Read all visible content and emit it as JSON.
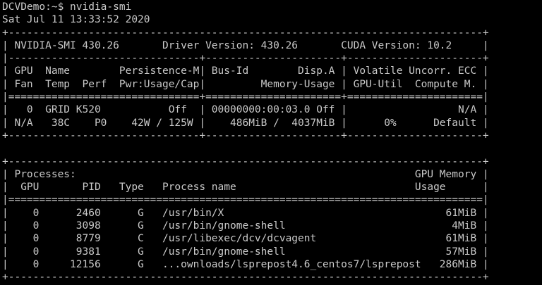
{
  "terminal": {
    "prompt_line": "DCVDemo:~$ nvidia-smi",
    "timestamp_line": "Sat Jul 11 13:33:52 2020",
    "gpu_table": [
      "+-----------------------------------------------------------------------------+",
      "| NVIDIA-SMI 430.26       Driver Version: 430.26       CUDA Version: 10.2     |",
      "|-------------------------------+----------------------+----------------------+",
      "| GPU  Name        Persistence-M| Bus-Id        Disp.A | Volatile Uncorr. ECC |",
      "| Fan  Temp  Perf  Pwr:Usage/Cap|         Memory-Usage | GPU-Util  Compute M. |",
      "|===============================+======================+======================|",
      "|   0  GRID K520           Off  | 00000000:00:03.0 Off |                  N/A |",
      "| N/A   38C    P0    42W / 125W |    486MiB /  4037MiB |      0%      Default |",
      "+-------------------------------+----------------------+----------------------+"
    ],
    "blank_line": "",
    "process_table": [
      "+-----------------------------------------------------------------------------+",
      "| Processes:                                                       GPU Memory |",
      "|  GPU       PID   Type   Process name                             Usage      |",
      "|=============================================================================|",
      "|    0      2460      G   /usr/bin/X                                    61MiB |",
      "|    0      3098      G   /usr/bin/gnome-shell                           4MiB |",
      "|    0      8779      C   /usr/libexec/dcv/dcvagent                     61MiB |",
      "|    0      9381      G   /usr/bin/gnome-shell                          57MiB |",
      "|    0     12156      G   ...ownloads/lsprepost4.6_centos7/lsprepost   286MiB |",
      "+-----------------------------------------------------------------------------+"
    ]
  },
  "colors": {
    "background": "#000000",
    "text": "#c9c9c9"
  }
}
